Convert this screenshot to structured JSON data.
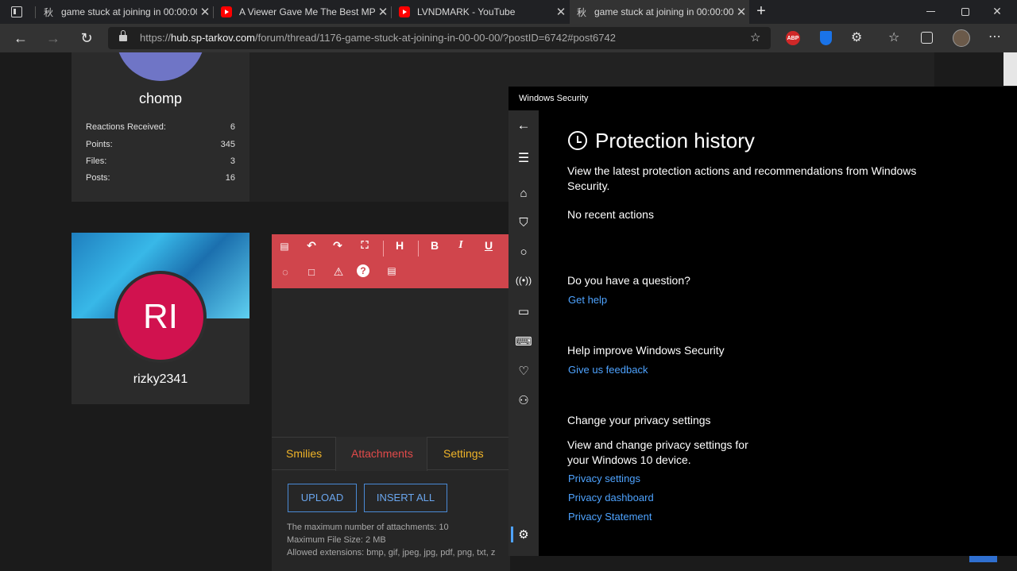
{
  "browser": {
    "tabs": [
      {
        "title": "game stuck at joining in 00:00:00",
        "icon": "tarkov-kanji-icon",
        "active": false
      },
      {
        "title": "A Viewer Gave Me The Best MP7",
        "icon": "youtube-icon",
        "active": false
      },
      {
        "title": "LVNDMARK - YouTube",
        "icon": "youtube-icon",
        "active": false
      },
      {
        "title": "game stuck at joining in 00:00:00",
        "icon": "tarkov-kanji-icon",
        "active": true
      }
    ],
    "url_prefix": "https://",
    "url_host": "hub.sp-tarkov.com",
    "url_path": "/forum/thread/1176-game-stuck-at-joining-in-00-00-00/?postID=6742#post6742",
    "abp_label": "ABP"
  },
  "forum": {
    "user1": {
      "name": "chomp",
      "stats": [
        {
          "label": "Reactions Received:",
          "value": "6"
        },
        {
          "label": "Points:",
          "value": "345"
        },
        {
          "label": "Files:",
          "value": "3"
        },
        {
          "label": "Posts:",
          "value": "16"
        }
      ]
    },
    "user2": {
      "name": "rizky2341",
      "initials": "RI"
    },
    "editor": {
      "tabs": [
        "Smilies",
        "Attachments",
        "Settings"
      ],
      "upload_label": "UPLOAD",
      "insert_all_label": "INSERT ALL",
      "info_lines": [
        "The maximum number of attachments: 10",
        "Maximum File Size: 2 MB",
        "Allowed extensions: bmp, gif, jpeg, jpg, pdf, png, txt, z"
      ]
    }
  },
  "windows_security": {
    "window_title": "Windows Security",
    "heading": "Protection history",
    "description": "View the latest protection actions and recommendations from Windows Security.",
    "status": "No recent actions",
    "question_heading": "Do you have a question?",
    "get_help": "Get help",
    "improve_heading": "Help improve Windows Security",
    "feedback": "Give us feedback",
    "privacy_heading": "Change your privacy settings",
    "privacy_desc": "View and change privacy settings for your Windows 10 device.",
    "privacy_links": [
      "Privacy settings",
      "Privacy dashboard",
      "Privacy Statement"
    ]
  },
  "colors": {
    "editor_toolbar": "#d0454c",
    "avatar_rizky": "#d1124f",
    "avatar_chomp": "#6f75c6",
    "tab_label": "#f0b429",
    "tab_active_label": "#e14a4a",
    "button_border": "#4a8ad6",
    "link": "#4ea3ff"
  }
}
